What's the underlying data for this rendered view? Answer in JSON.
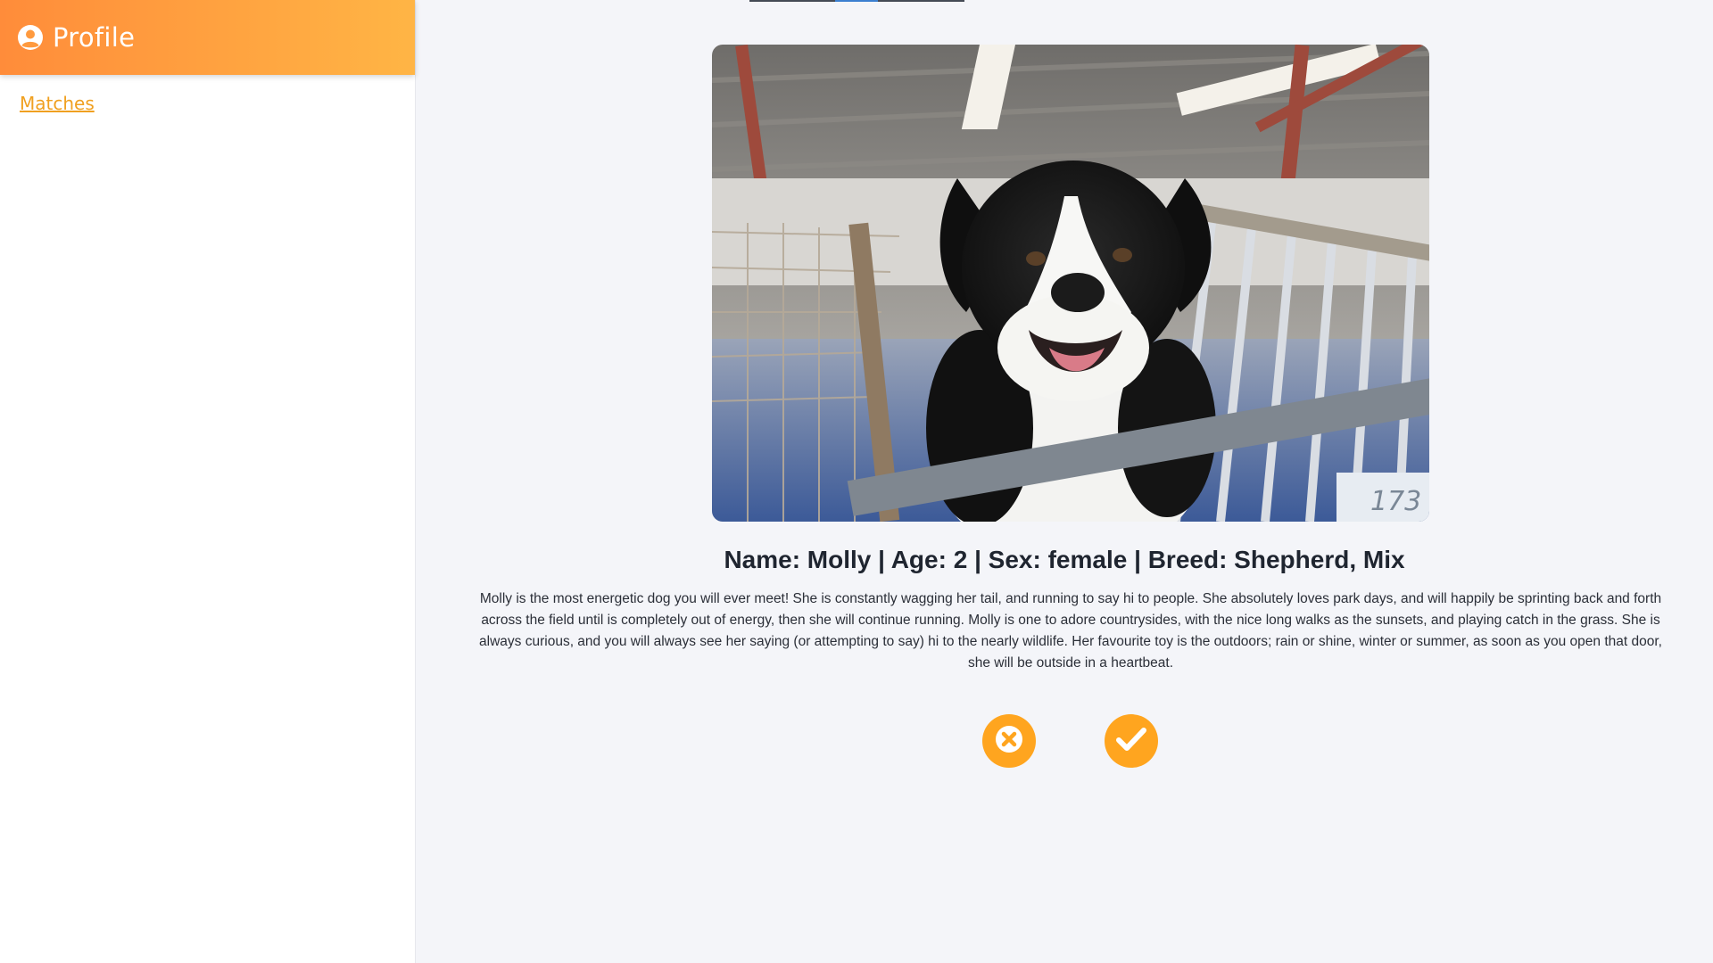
{
  "sidebar": {
    "title": "Profile",
    "icon": "user-circle-icon",
    "nav": [
      {
        "label": "Matches"
      }
    ]
  },
  "profile": {
    "photo_icon": "dog-photo",
    "info_line": "Name: Molly | Age: 2 | Sex: female | Breed: Shepherd, Mix",
    "bio": "Molly is the most energetic dog you will ever meet! She is constantly wagging her tail, and running to say hi to people. She absolutely loves park days, and will happily be sprinting back and forth across the field until is completely out of energy, then she will continue running. Molly is one to adore countrysides, with the nice long walks as the sunsets, and playing catch in the grass. She is always curious, and you will always see her saying (or attempting to say) hi to the nearly wildlife. Her favourite toy is the outdoors; rain or shine, winter or summer, as soon as you open that door, she will be outside in a heartbeat.",
    "photo_sign_text": "173"
  },
  "actions": {
    "reject_icon": "x-circle-icon",
    "accept_icon": "check-circle-icon"
  },
  "colors": {
    "header_gradient_start": "#ff8c3a",
    "header_gradient_end": "#ffb545",
    "accent": "#ffa51f",
    "link": "#f0a020",
    "background": "#f4f5f9"
  }
}
